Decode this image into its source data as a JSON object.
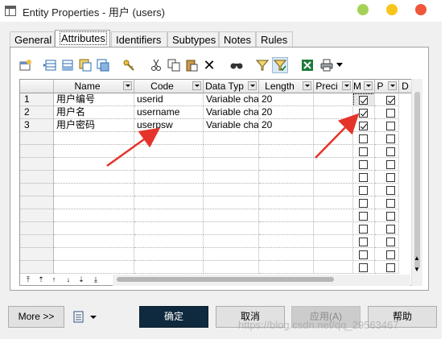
{
  "window": {
    "title": "Entity Properties - 用户 (users)"
  },
  "tabs": [
    {
      "label": "General"
    },
    {
      "label": "Attributes"
    },
    {
      "label": "Identifiers"
    },
    {
      "label": "Subtypes"
    },
    {
      "label": "Notes"
    },
    {
      "label": "Rules"
    }
  ],
  "toolbar": {
    "icons": [
      "properties-icon",
      "insert-row-icon",
      "add-row-icon",
      "add-attributes-icon",
      "reuse-attributes-icon",
      "new-key-icon",
      "cut-icon",
      "copy-icon",
      "paste-icon",
      "delete-icon",
      "find-icon",
      "filter-icon",
      "filter-active-icon",
      "export-excel-icon",
      "print-icon",
      "print-dropdown-icon"
    ]
  },
  "grid": {
    "columns": [
      {
        "label": "Name"
      },
      {
        "label": "Code"
      },
      {
        "label": "Data Typ"
      },
      {
        "label": "Length"
      },
      {
        "label": "Preci"
      },
      {
        "label": "M"
      },
      {
        "label": "P"
      },
      {
        "label": "D"
      }
    ],
    "rows": [
      {
        "num": "1",
        "name": "用户编号",
        "code": "userid",
        "type": "Variable char",
        "length": "20",
        "m": true,
        "p": true
      },
      {
        "num": "2",
        "name": "用户名",
        "code": "username",
        "type": "Variable char",
        "length": "20",
        "m": true,
        "p": false
      },
      {
        "num": "3",
        "name": "用户密码",
        "code": "userpsw",
        "type": "Variable char",
        "length": "20",
        "m": true,
        "p": false
      }
    ]
  },
  "nav_glyphs": [
    "⤒",
    "⇡",
    "↑",
    "↓",
    "⇣",
    "⤓"
  ],
  "buttons": {
    "more": "More >>",
    "ok": "确定",
    "cancel": "取消",
    "apply": "应用(A)",
    "help": "帮助"
  },
  "watermark": "https://blog.csdn.net/qq_29563467",
  "colors": {
    "accent_arrow": "#e5332a",
    "ok_button": "#0f2a3f",
    "dot_green": "#a6d158",
    "dot_yellow": "#f8c51c",
    "dot_red": "#f0563b"
  }
}
